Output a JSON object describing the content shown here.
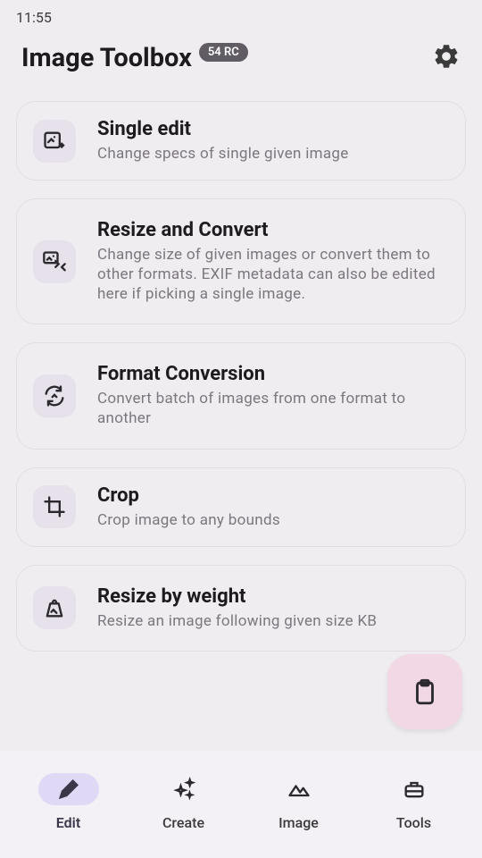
{
  "status": {
    "time": "11:55"
  },
  "header": {
    "title": "Image Toolbox",
    "badge": "54 RC"
  },
  "cards": [
    {
      "title": "Single edit",
      "desc": "Change specs of single given image"
    },
    {
      "title": "Resize and Convert",
      "desc": "Change size of given images or convert them to other formats. EXIF metadata can also be edited here if picking a single image."
    },
    {
      "title": "Format Conversion",
      "desc": "Convert batch of images from one format to another"
    },
    {
      "title": "Crop",
      "desc": "Crop image to any bounds"
    },
    {
      "title": "Resize by weight",
      "desc": "Resize an image following given size KB"
    }
  ],
  "nav": [
    {
      "label": "Edit"
    },
    {
      "label": "Create"
    },
    {
      "label": "Image"
    },
    {
      "label": "Tools"
    }
  ]
}
